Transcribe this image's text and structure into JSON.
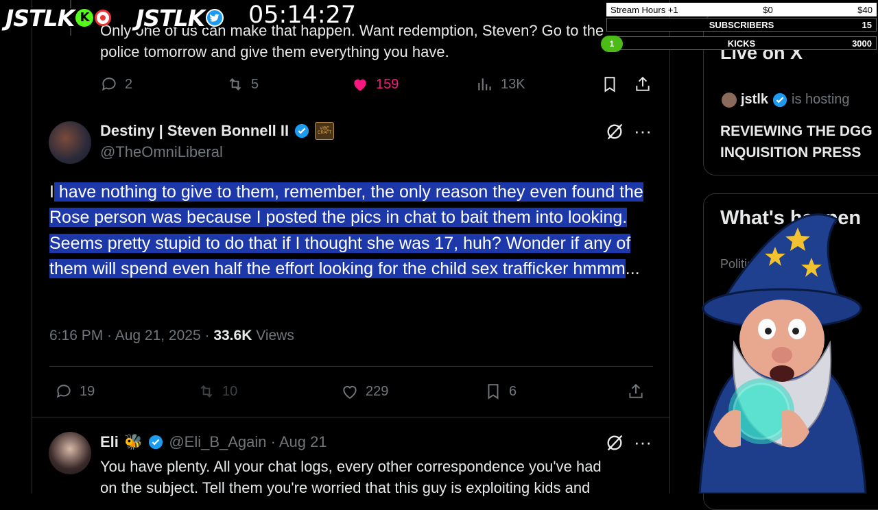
{
  "overlay": {
    "brand1": "JSTLK",
    "brand2": "JSTLK",
    "timer": "05:14:27",
    "goals": [
      {
        "label": "Stream Hours +1",
        "mid": "$0",
        "value": "$40"
      },
      {
        "label": "SUBSCRIBERS",
        "value": "15"
      },
      {
        "label": "KICKS",
        "value": "3000",
        "badge": "1"
      }
    ]
  },
  "prev_tweet": {
    "text_line1": "Only one of us can make that happen. Want redemption, Steven? Go to the",
    "text_line2": "police tomorrow and give them everything you have.",
    "replies": "2",
    "reposts": "5",
    "likes": "159",
    "views": "13K"
  },
  "main_tweet": {
    "display_name": "Destiny | Steven Bonnell II",
    "handle": "@TheOmniLiberal",
    "badge_text": "VIBE CRAFT",
    "text_first_char": "I",
    "text_highlighted": " have nothing to give to them, remember, the only reason they even found the Rose person was because I posted the pics in chat to bait them into looking. Seems pretty stupid to do that if I thought she was 17, huh? Wonder if any of them will spend even half the effort looking for the child sex trafficker hmmm",
    "text_tail": "...",
    "time": "6:16 PM · Aug 21, 2025 · ",
    "views_count": "33.6K",
    "views_label": " Views",
    "replies": "19",
    "reposts": "10",
    "likes": "229",
    "bookmarks": "6"
  },
  "reply_tweet": {
    "display_name": "Eli",
    "emoji": "🐝",
    "handle_date": "@Eli_B_Again · Aug 21",
    "text_line1": "You have plenty. All your chat logs, every other correspondence you've had",
    "text_line2": "on the subject. Tell them you're worried that this guy is exploiting kids and"
  },
  "sidebar": {
    "live_title": "Live on X",
    "host_name": "jstlk",
    "host_suffix": "is hosting",
    "space_title_line1": "REVIEWING THE DGG",
    "space_title_line2": "INQUISITION PRESS",
    "happening_title": "What's happen",
    "trend_category": "Politics · Trending"
  },
  "colors": {
    "like_pink": "#f91880",
    "verified_blue": "#1d9bf0",
    "highlight": "#1d38a8",
    "muted": "#71767b",
    "divider": "#2f3336"
  }
}
